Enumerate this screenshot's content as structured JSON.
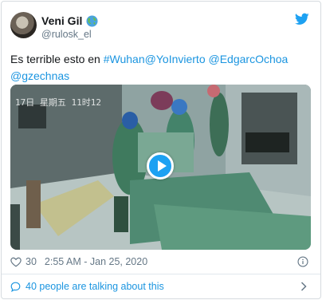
{
  "user": {
    "display_name": "Veni Gil",
    "handle": "@rulosk_el",
    "badge_icon": "globe-icon"
  },
  "brand_icon": "twitter-bird-icon",
  "tweet": {
    "text_prefix": "Es terrible esto en ",
    "hashtag": "#Wuhan",
    "mention_1": "@YoInvierto",
    "separator": " ",
    "mention_2": "@EdgarcOchoa",
    "mention_3": "@gzechnas"
  },
  "media": {
    "type": "video",
    "overlay_timestamp": "17日 星期五 11时12",
    "play_icon": "play-icon"
  },
  "meta": {
    "likes": "30",
    "time": "2:55 AM - Jan 25, 2020",
    "like_icon": "heart-icon",
    "info_icon": "info-icon"
  },
  "talking": {
    "label": "40 people are talking about this",
    "icon": "comment-icon",
    "chevron_icon": "chevron-right-icon"
  },
  "colors": {
    "link": "#1b95e0",
    "secondary_text": "#657786",
    "brand": "#1da1f2"
  }
}
